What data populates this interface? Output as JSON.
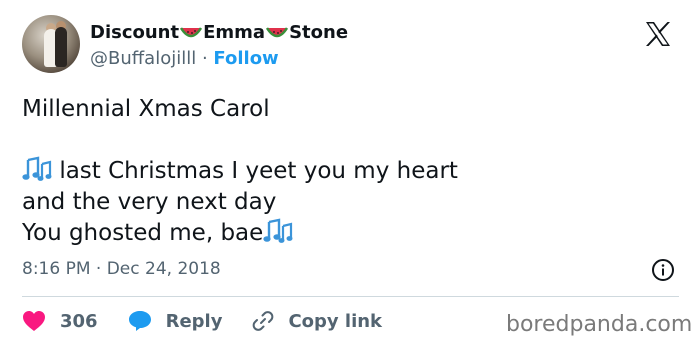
{
  "author": {
    "name_part1": "Discount",
    "name_part2": "Emma",
    "name_part3": "Stone",
    "name_icon": "watermelon-icon",
    "handle": "@Buffalojilll",
    "separator": "·",
    "follow_label": "Follow"
  },
  "platform_icon": "x-logo-icon",
  "tweet": {
    "line1": "Millennial Xmas Carol",
    "line2": "last Christmas I yeet you my heart",
    "line3": "and the very next day",
    "line4": "You ghosted me, bae",
    "emoji_icon": "music-notes-icon"
  },
  "meta": {
    "time": "8:16 PM",
    "separator": "·",
    "date": "Dec 24, 2018",
    "info_icon": "info-icon"
  },
  "actions": {
    "like_count": "306",
    "reply_label": "Reply",
    "copy_link_label": "Copy link"
  },
  "watermark": "boredpanda.com",
  "colors": {
    "like": "#f91880",
    "reply": "#1d9bf0",
    "follow": "#1d9bf0",
    "secondary_text": "#536471",
    "divider": "#cfd9de"
  }
}
